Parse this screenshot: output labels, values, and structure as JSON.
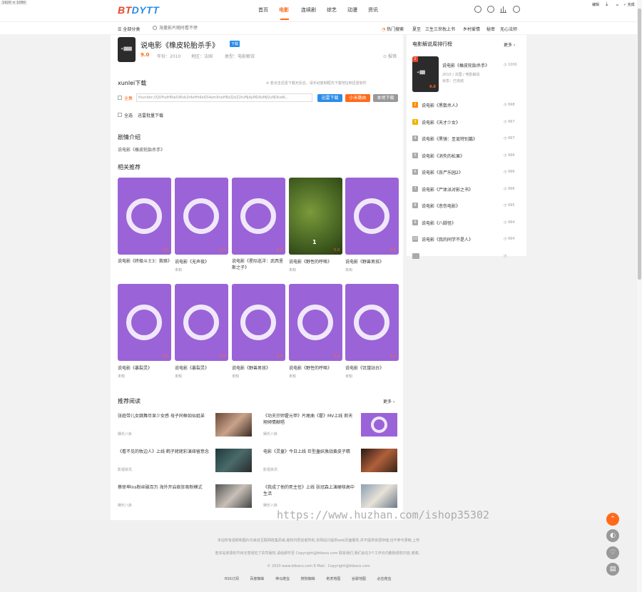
{
  "corner": {
    "dims": "1920 × 1080",
    "edit": "编辑",
    "done": "完成"
  },
  "header": {
    "logo_red": "BT",
    "logo_blue": "DYTT",
    "nav": [
      "首页",
      "电影",
      "连续剧",
      "综艺",
      "动漫",
      "资讯"
    ]
  },
  "subbar": {
    "all_categories": "全部分类",
    "search_placeholder": "海量影片随时看不停",
    "hot_label": "热门搜索",
    "hot_items": [
      "夏至",
      "三生三世枕上书",
      "乡村爱情",
      "秘密",
      "无心法师"
    ]
  },
  "movie": {
    "title": "说电影《橡皮轮胎杀手》",
    "badge": "下载",
    "score": "9.0",
    "year": "年份：2010",
    "region": "地区：法国",
    "type": "类型：电影解说",
    "report": "报错"
  },
  "download": {
    "heading": "xunlei下载",
    "note": "※ 若点击迅雷下载无反应，请手动复制框内下载地址到迅雷软件",
    "item_label": "全集",
    "link": "thunder://QUFodHRwOi8vb2t4eHh6eS54em9neHBzZjlsZ2tvMjAyMDAzMjQvNDkwN...",
    "btn_xunlei": "迅雷下载",
    "btn_xiaomi": "小米路由",
    "btn_local": "本地下载",
    "select_all": "全选",
    "batch": "迅雷批量下载"
  },
  "synopsis": {
    "heading": "剧情介绍",
    "text": "说电影《橡皮轮胎杀手》"
  },
  "related": {
    "heading": "相关推荐",
    "row1": [
      {
        "title": "说电影《终极斗士3：救赎》",
        "score": "9.0",
        "sub": ""
      },
      {
        "title": "说电影《无声夜》",
        "score": "9.0",
        "sub": "未知"
      },
      {
        "title": "说电影《星际巡洋：武西里斯之子》",
        "score": "9.0",
        "sub": ""
      },
      {
        "title": "说电影《野性的呼唤》",
        "score": "5.0",
        "sub": "未知",
        "overlay": "1"
      },
      {
        "title": "说电影《野兽男孩》",
        "score": "9.0",
        "sub": "未知"
      }
    ],
    "row2": [
      {
        "title": "说电影《暴裂灵》",
        "score": "9.0",
        "sub": "未知"
      },
      {
        "title": "说电影《暴裂灵》",
        "score": "9.0",
        "sub": "未知"
      },
      {
        "title": "说电影《野兽男孩》",
        "score": "9.0",
        "sub": "未知"
      },
      {
        "title": "说电影《野性的呼唤》",
        "score": "5.0",
        "sub": "未知"
      },
      {
        "title": "说电影《饥饿站台》",
        "score": "9.0",
        "sub": "未知"
      }
    ]
  },
  "reading": {
    "heading": "推荐阅读",
    "more": "更多",
    "items": [
      {
        "title": "张庭带儿女跳舞尽显少女感 母子同框如似姐弟",
        "tag": "娱乐八卦"
      },
      {
        "title": "《功夫宗师霍元甲》片尾曲《霍》MV上线 郎天翔倾情献唱",
        "tag": "娱乐八卦"
      },
      {
        "title": "《看不见的牧边人》上线 鹤子姥姥彩演绎留意念",
        "tag": "影视资讯"
      },
      {
        "title": "电影《灵童》今日上线 巨型蛊妖激战黄皮子精",
        "tag": "影视资讯"
      },
      {
        "title": "蔡徐坤ins粉丝破百万 海外开启疯狂吸粉模式",
        "tag": "娱乐八卦"
      },
      {
        "title": "《我成了他的死主任》上线 张冠森上演硬核高中生活",
        "tag": "娱乐八卦"
      }
    ]
  },
  "ranking": {
    "heading": "电影解说周排行榜",
    "more": "更多",
    "top": {
      "rank": "1",
      "title": "说电影《橡皮轮胎杀手》",
      "views": "1000",
      "meta": "2010 / 法国 / 电影解说",
      "status": "状态：已完结",
      "score": "9.0"
    },
    "items": [
      {
        "rank": "2",
        "title": "说电影《黑数杀人》",
        "views": "998"
      },
      {
        "rank": "3",
        "title": "说电影《天才少女》",
        "views": "997"
      },
      {
        "rank": "4",
        "title": "说电影《黑镜：圣诞特别篇》",
        "views": "997"
      },
      {
        "rank": "5",
        "title": "说电影《消失的松果》",
        "views": "996"
      },
      {
        "rank": "6",
        "title": "说电影《丧尸乐园2》",
        "views": "996"
      },
      {
        "rank": "7",
        "title": "说电影《尸体派对影之书》",
        "views": "996"
      },
      {
        "rank": "8",
        "title": "说电影《悲伤电影》",
        "views": "995"
      },
      {
        "rank": "9",
        "title": "说电影《八脚怪》",
        "views": "994"
      },
      {
        "rank": "10",
        "title": "说电影《我的同学不是人》",
        "views": "994"
      }
    ]
  },
  "footer": {
    "line1": "本站所有视频和图片均来自互联网收集而来,版权归原创者所有,本网站只提供web页面服务,并不提供资源存储,也不参与录制,上传",
    "line2": "若本站收录的节目无意侵犯了贵司版权,请给邮件至 Copyright@btbans.com 联系我们,我们会在3个工作日内删除侵权内容,谢谢。",
    "line3": "© 2020 www.btbans.com  E-Mail：Copyright@btbans.com",
    "links": [
      "RSS订阅",
      "百度蜘蛛",
      "神马爬虫",
      "搜狗蜘蛛",
      "奇虎地图",
      "谷歌地图",
      "必应爬虫"
    ]
  },
  "watermark": "https://www.huzhan.com/ishop35302",
  "colors": {
    "accent": "#ff6a1a",
    "purple": "#9b63d8",
    "blue": "#2b8ce8",
    "red": "#e8452b"
  }
}
